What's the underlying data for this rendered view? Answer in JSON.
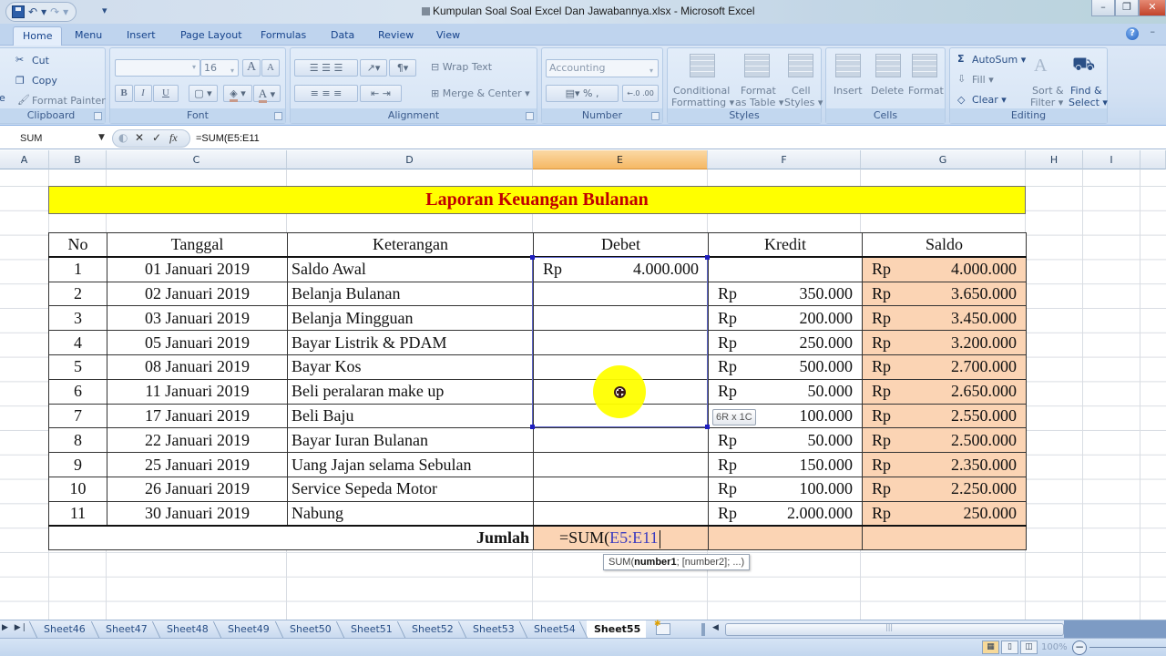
{
  "window": {
    "title": "Kumpulan Soal Soal Excel Dan Jawabannya.xlsx - Microsoft Excel",
    "controls": {
      "minimize": "–",
      "restore": "❐",
      "close": "✕"
    }
  },
  "quick_access": {
    "save": "save-icon",
    "undo": "↶",
    "redo": "↷",
    "more": "▾"
  },
  "ribbon": {
    "tabs": [
      "Home",
      "Menu",
      "Insert",
      "Page Layout",
      "Formulas",
      "Data",
      "Review",
      "View"
    ],
    "active_tab": "Home",
    "clipboard": {
      "label": "Clipboard",
      "paste": "e",
      "cut": "Cut",
      "copy": "Copy",
      "format_painter": "Format Painter"
    },
    "font": {
      "label": "Font",
      "font_name": "",
      "font_size": "16",
      "grow": "A",
      "shrink": "A",
      "bold": "B",
      "italic": "I",
      "underline": "U",
      "font_color": "A"
    },
    "alignment": {
      "label": "Alignment",
      "wrap_text": "Wrap Text",
      "merge_center": "Merge & Center"
    },
    "number": {
      "label": "Number",
      "format": "Accounting",
      "percent": "%",
      "comma": ",",
      "inc_decimal": ".00",
      "dec_decimal": ".0"
    },
    "styles": {
      "label": "Styles",
      "conditional": [
        "Conditional",
        "Formatting ▾"
      ],
      "format_table": [
        "Format",
        "as Table ▾"
      ],
      "cell_styles": [
        "Cell",
        "Styles ▾"
      ]
    },
    "cells": {
      "label": "Cells",
      "insert": "Insert",
      "delete": "Delete",
      "format": "Format"
    },
    "editing": {
      "label": "Editing",
      "autosum": "AutoSum ▾",
      "fill": "Fill ▾",
      "clear": "Clear ▾",
      "sort_filter": [
        "Sort &",
        "Filter ▾"
      ],
      "find_select": [
        "Find &",
        "Select ▾"
      ]
    }
  },
  "formula_bar": {
    "name_box": "SUM",
    "cancel": "✕",
    "enter": "✓",
    "fx": "fx",
    "formula": "=SUM(E5:E11"
  },
  "columns": [
    "A",
    "B",
    "C",
    "D",
    "E",
    "F",
    "G",
    "H",
    "I"
  ],
  "selected_column": "E",
  "report": {
    "title": "Laporan Keuangan Bulanan",
    "headers": [
      "No",
      "Tanggal",
      "Keterangan",
      "Debet",
      "Kredit",
      "Saldo"
    ],
    "currency": "Rp",
    "rows": [
      {
        "no": "1",
        "date": "01 Januari 2019",
        "desc": "Saldo Awal",
        "debet": "4.000.000",
        "kredit": "",
        "saldo": "4.000.000"
      },
      {
        "no": "2",
        "date": "02 Januari 2019",
        "desc": "Belanja Bulanan",
        "debet": "",
        "kredit": "350.000",
        "saldo": "3.650.000"
      },
      {
        "no": "3",
        "date": "03 Januari 2019",
        "desc": "Belanja Mingguan",
        "debet": "",
        "kredit": "200.000",
        "saldo": "3.450.000"
      },
      {
        "no": "4",
        "date": "05 Januari 2019",
        "desc": "Bayar Listrik & PDAM",
        "debet": "",
        "kredit": "250.000",
        "saldo": "3.200.000"
      },
      {
        "no": "5",
        "date": "08 Januari 2019",
        "desc": "Bayar Kos",
        "debet": "",
        "kredit": "500.000",
        "saldo": "2.700.000"
      },
      {
        "no": "6",
        "date": "11 Januari 2019",
        "desc": "Beli peralaran make up",
        "debet": "",
        "kredit": "50.000",
        "saldo": "2.650.000"
      },
      {
        "no": "7",
        "date": "17 Januari 2019",
        "desc": "Beli Baju",
        "debet": "",
        "kredit": "100.000",
        "saldo": "2.550.000"
      },
      {
        "no": "8",
        "date": "22 Januari 2019",
        "desc": "Bayar Iuran Bulanan",
        "debet": "",
        "kredit": "50.000",
        "saldo": "2.500.000"
      },
      {
        "no": "9",
        "date": "25 Januari 2019",
        "desc": "Uang Jajan selama Sebulan",
        "debet": "",
        "kredit": "150.000",
        "saldo": "2.350.000"
      },
      {
        "no": "10",
        "date": "26 Januari 2019",
        "desc": "Service Sepeda Motor",
        "debet": "",
        "kredit": "100.000",
        "saldo": "2.250.000"
      },
      {
        "no": "11",
        "date": "30 Januari 2019",
        "desc": "Nabung",
        "debet": "",
        "kredit": "2.000.000",
        "saldo": "250.000"
      }
    ],
    "total_label": "Jumlah",
    "total_formula_prefix": "=SUM(",
    "total_formula_ref": "E5:E11"
  },
  "tooltips": {
    "range_size": "6R x 1C",
    "function_hint_prefix": "SUM(",
    "function_hint_bold": "number1",
    "function_hint_rest": "; [number2]; ...)"
  },
  "sheets": [
    "Sheet46",
    "Sheet47",
    "Sheet48",
    "Sheet49",
    "Sheet50",
    "Sheet51",
    "Sheet52",
    "Sheet53",
    "Sheet54",
    "Sheet55"
  ],
  "active_sheet": "Sheet55",
  "status": {
    "zoom": "100%",
    "zoom_out": "−"
  },
  "colors": {
    "title_band": "#ffff00",
    "title_text": "#c00000",
    "saldo_fill": "#fbd4b4",
    "selection": "#5c64c8"
  }
}
